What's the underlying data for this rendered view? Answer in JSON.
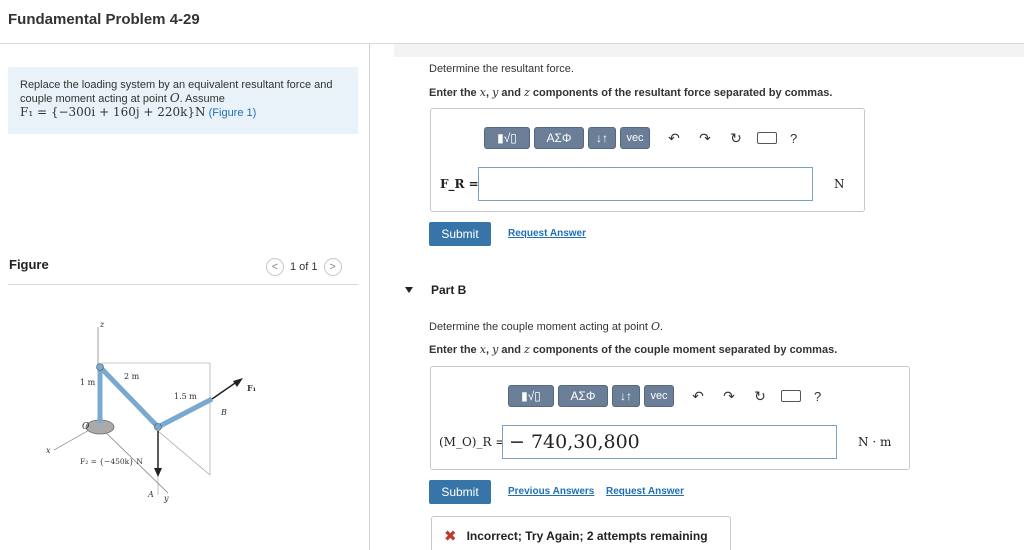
{
  "page_title": "Fundamental Problem 4-29",
  "problem": {
    "text": "Replace the loading system by an equivalent resultant force and couple moment acting at point",
    "point": "O",
    "assume": ". Assume",
    "equation": "F₁ = {−300i + 160j + 220k}N",
    "figure_link": "(Figure 1)"
  },
  "figure": {
    "label": "Figure",
    "pager_text": "1 of 1",
    "prev_icon": "chevron-left-icon",
    "next_icon": "chevron-right-icon",
    "labels": {
      "z": "z",
      "x": "x",
      "y": "y",
      "o": "O",
      "a": "A",
      "b": "B",
      "f1": "F₁",
      "f2": "F₂ = {−450k} N",
      "dim1": "1 m",
      "dim2": "2 m",
      "dim3": "1.5 m"
    }
  },
  "part_a": {
    "prompt1": "Determine the resultant force.",
    "prompt2_pre": "Enter the",
    "prompt2_x": "x",
    "prompt2_mid1": ",",
    "prompt2_y": "y",
    "prompt2_mid2": "and",
    "prompt2_z": "z",
    "prompt2_post": "components of the resultant force separated by commas.",
    "toolbar": {
      "b1": "▮√▯",
      "b2": "ΑΣΦ",
      "b3": "↓↑",
      "b4": "vec",
      "undo": "↶",
      "redo": "↷",
      "reset": "↻",
      "help": "?"
    },
    "input_label": "F_R =",
    "input_value": "",
    "unit": "N",
    "submit": "Submit",
    "request_answer": "Request Answer"
  },
  "part_b": {
    "header": "Part B",
    "prompt1": "Determine the couple moment acting at point",
    "prompt1_point": "O",
    "prompt2_pre": "Enter the",
    "prompt2_x": "x",
    "prompt2_mid1": ",",
    "prompt2_y": "y",
    "prompt2_mid2": "and",
    "prompt2_z": "z",
    "prompt2_post": "components of the couple moment separated by commas.",
    "toolbar": {
      "b1": "▮√▯",
      "b2": "ΑΣΦ",
      "b3": "↓↑",
      "b4": "vec",
      "undo": "↶",
      "redo": "↷",
      "reset": "↻",
      "help": "?"
    },
    "input_label": "(M_O)_R =",
    "input_value": "− 740,30,800",
    "unit": "N · m",
    "submit": "Submit",
    "previous_answers": "Previous Answers",
    "request_answer": "Request Answer",
    "feedback": "Incorrect; Try Again; 2 attempts remaining"
  }
}
